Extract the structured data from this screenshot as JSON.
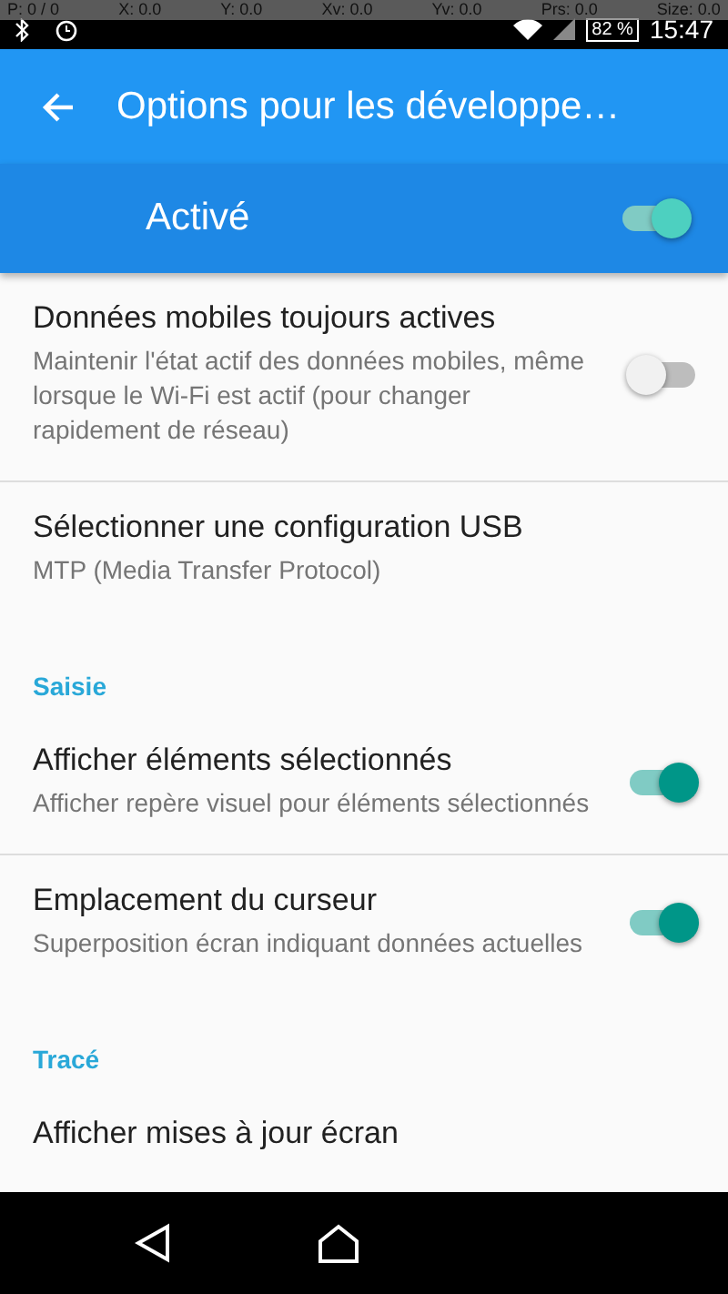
{
  "pointer_overlay": [
    "P: 0 / 0",
    "X: 0.0",
    "Y: 0.0",
    "Xv: 0.0",
    "Yv: 0.0",
    "Prs: 0.0",
    "Size: 0.0"
  ],
  "status_bar": {
    "battery": "82 %",
    "time": "15:47"
  },
  "toolbar": {
    "title": "Options pour les développe…"
  },
  "master_switch": {
    "label": "Activé",
    "on": true
  },
  "list": [
    {
      "kind": "switch",
      "title": "Données mobiles toujours actives",
      "summary": "Maintenir l'état actif des données mobiles, même lorsque le Wi-Fi est actif (pour changer rapidement de réseau)",
      "on": false,
      "divider": true
    },
    {
      "kind": "item",
      "title": "Sélectionner une configuration USB",
      "summary": "MTP (Media Transfer Protocol)",
      "divider": false
    },
    {
      "kind": "header",
      "title": "Saisie"
    },
    {
      "kind": "switch",
      "title": "Afficher éléments sélectionnés",
      "summary": "Afficher repère visuel pour éléments sélectionnés",
      "on": true,
      "divider": true
    },
    {
      "kind": "switch",
      "title": "Emplacement du curseur",
      "summary": "Superposition écran indiquant données actuelles",
      "on": true,
      "divider": false
    },
    {
      "kind": "header",
      "title": "Tracé"
    },
    {
      "kind": "item",
      "title": "Afficher mises à jour écran",
      "divider": false
    }
  ]
}
